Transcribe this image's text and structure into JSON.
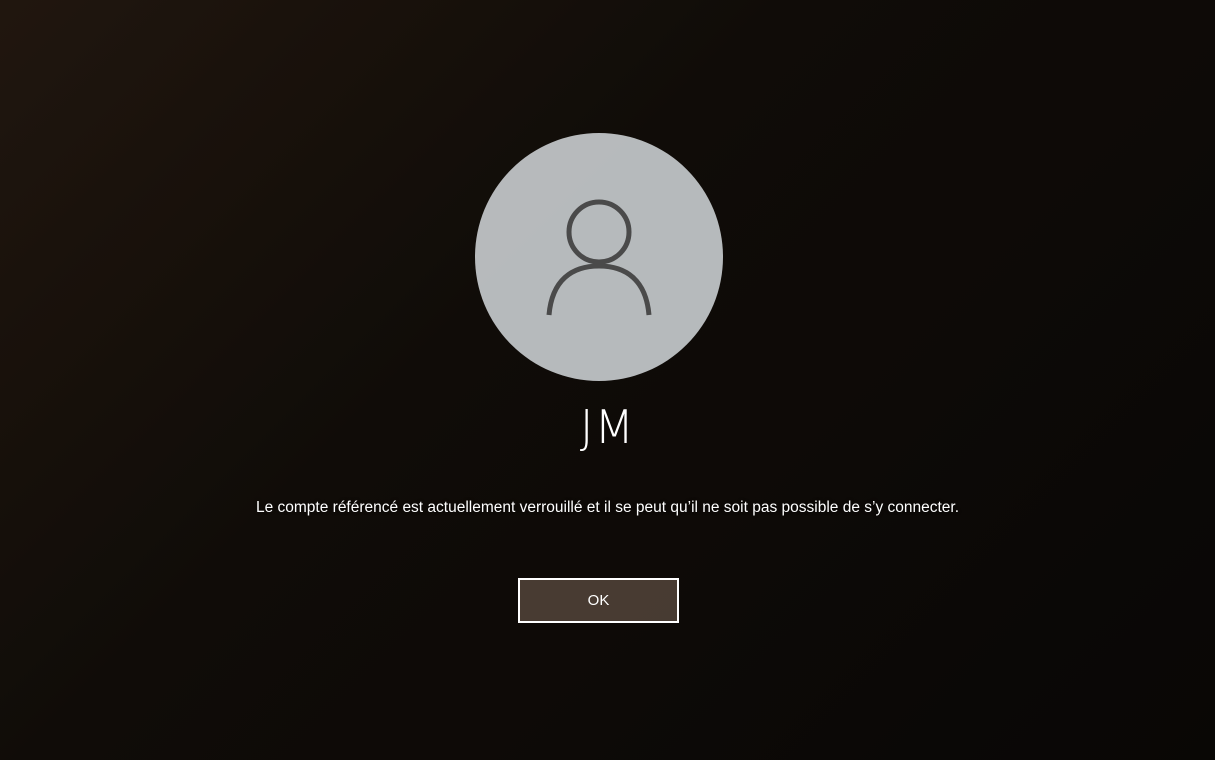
{
  "lock_screen": {
    "username": "JM",
    "message": "Le compte référencé est actuellement verrouillé et il se peut qu’il ne soit pas possible de s’y connecter.",
    "ok_label": "OK"
  },
  "avatar": {
    "icon": "user-icon",
    "background_color": "#dcdfe3",
    "icon_color": "#4a4a4a"
  },
  "wallpaper": {
    "description_icon": "cave-beach-wallpaper"
  }
}
